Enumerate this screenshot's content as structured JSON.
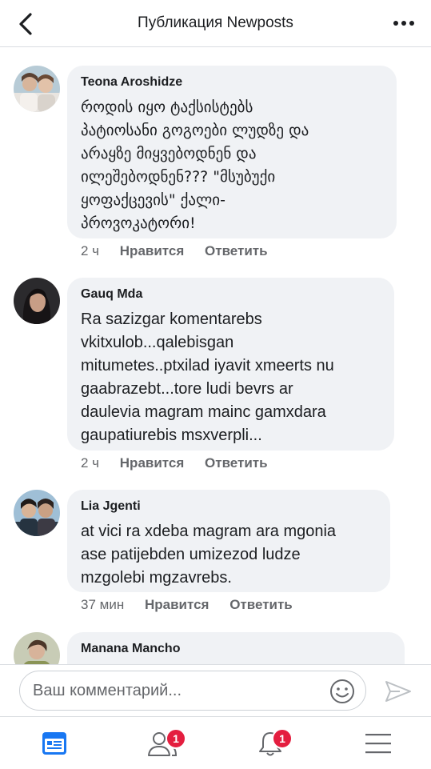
{
  "header": {
    "title": "Публикация Newposts"
  },
  "comments": [
    {
      "author": "Teona Aroshidze",
      "text": "როდის იყო ტაქსისტებს\nპატიოსანი გოგოები ლუდზე და\nარაყზე მიყვებოდნენ და\nილეშებოდნენ??? \"მსუბუქი\nყოფაქცევის\" ქალი-\nპროვოკატორი!",
      "time": "2 ч",
      "like": "Нравится",
      "reply": "Ответить"
    },
    {
      "author": "Gauq Mda",
      "text": "Ra sazizgar komentarebs\nvkitxulob...qalebisgan\nmitumetes..ptxilad iyavit xmeerts nu\ngaabrazebt...tore ludi bevrs ar\ndaulevia magram mainc gamxdara\ngaupatiurebis msxverpli...",
      "time": "2 ч",
      "like": "Нравится",
      "reply": "Ответить"
    },
    {
      "author": "Lia Jgenti",
      "text": "at vici ra xdeba magram ara mgonia\nase patijebden umizezod ludze\nmzgolebi mgzavrebs.",
      "time": "37 мин",
      "like": "Нравится",
      "reply": "Ответить"
    },
    {
      "author": "Manana Mancho",
      "text": "",
      "time": "",
      "like": "",
      "reply": ""
    }
  ],
  "composer": {
    "placeholder": "Ваш комментарий..."
  },
  "tabbar": {
    "friends_badge": "1",
    "notifications_badge": "1"
  },
  "colors": {
    "accent": "#1877f2",
    "badge": "#e41e3f",
    "bubble": "#f0f2f5",
    "muted": "#65676b"
  }
}
